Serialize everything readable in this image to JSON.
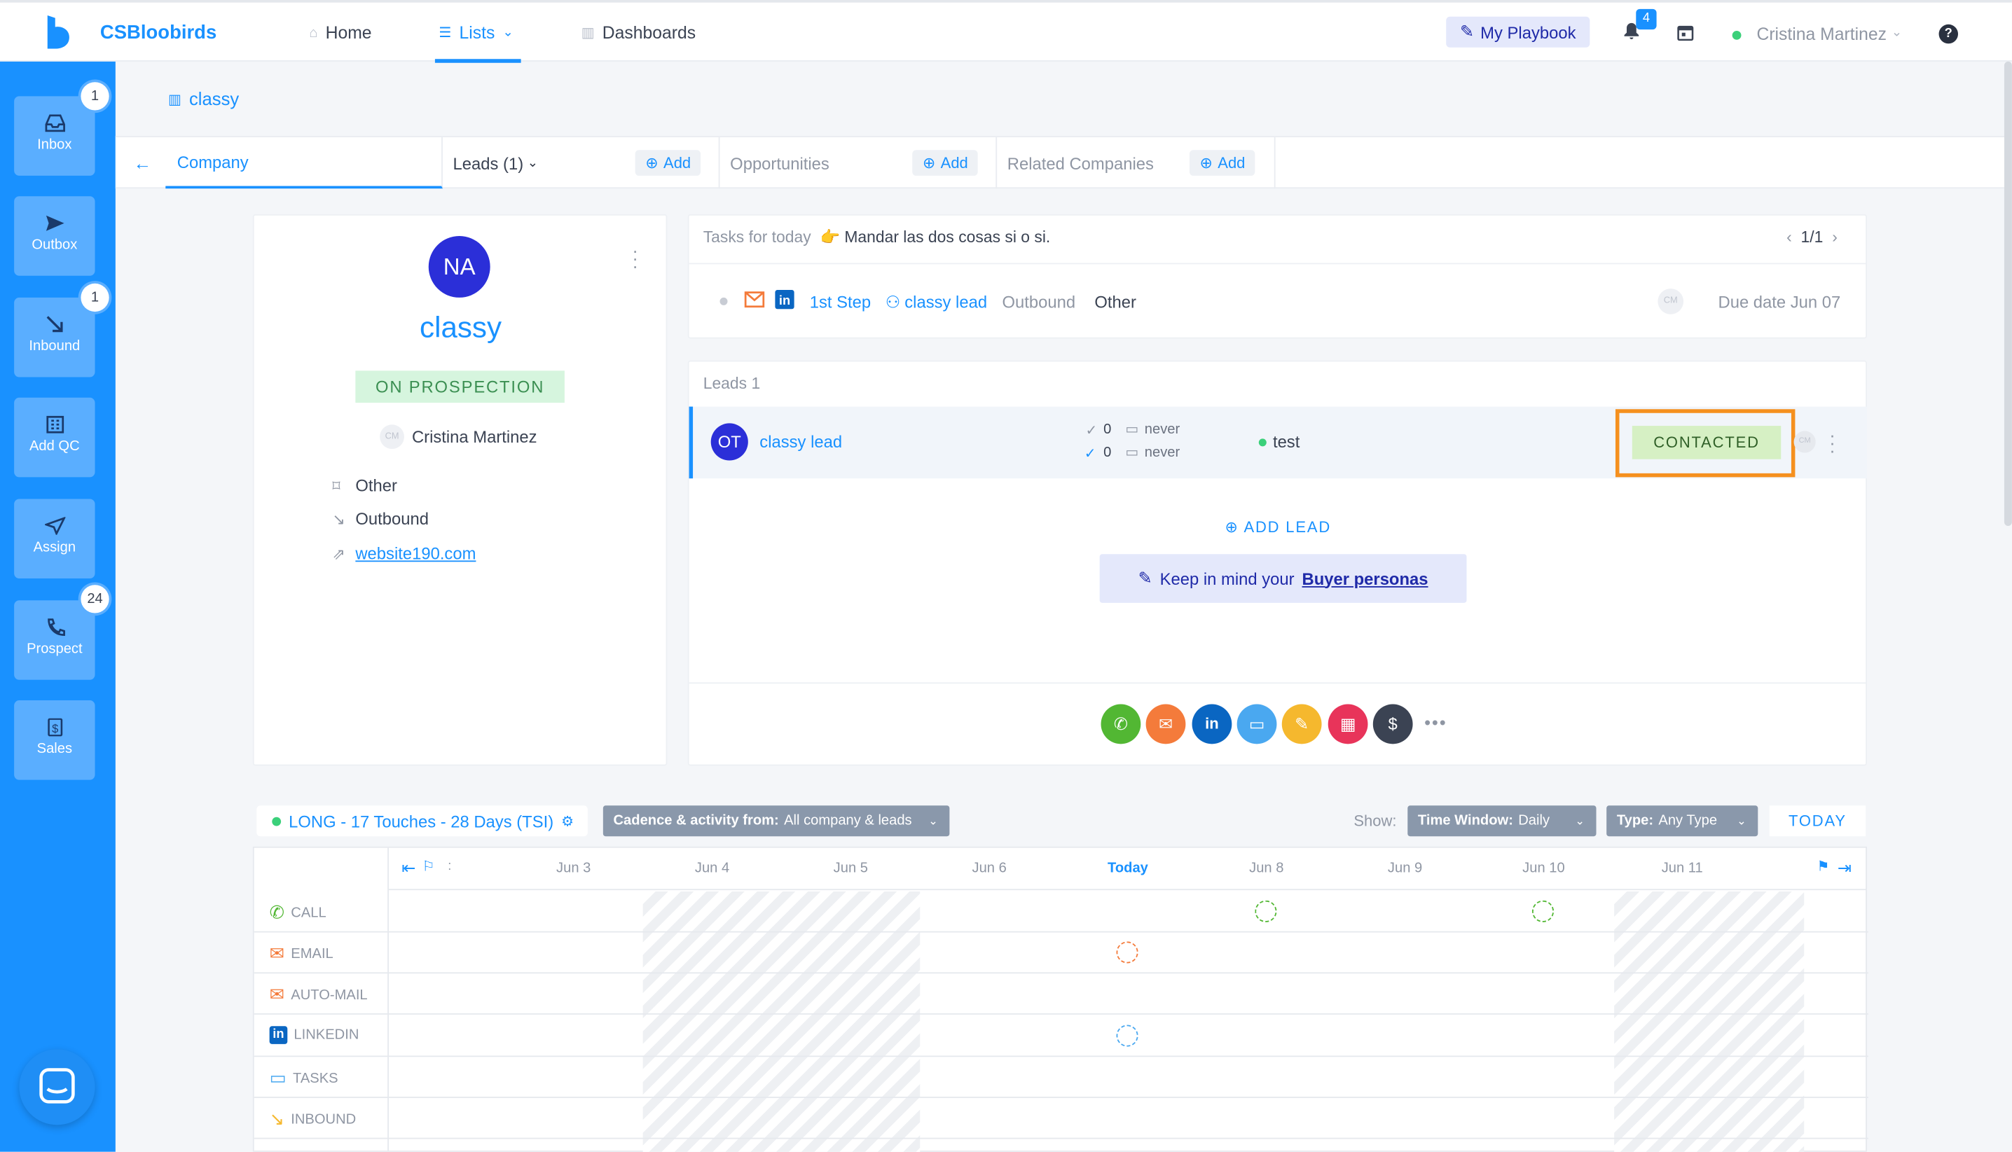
{
  "app": {
    "name": "CSBloobirds"
  },
  "topnav": {
    "home": "Home",
    "lists": "Lists",
    "dashboards": "Dashboards",
    "playbook": "My Playbook",
    "notifications": "4",
    "user": "Cristina Martinez",
    "help": "?"
  },
  "sidebar": {
    "items": [
      {
        "label": "Inbox",
        "badge": "1",
        "icon": "inbox-icon"
      },
      {
        "label": "Outbox",
        "badge": "",
        "icon": "send-icon"
      },
      {
        "label": "Inbound",
        "badge": "1",
        "icon": "arrow-down-right-icon"
      },
      {
        "label": "Add QC",
        "badge": "",
        "icon": "building-icon"
      },
      {
        "label": "Assign",
        "badge": "",
        "icon": "navigation-icon"
      },
      {
        "label": "Prospect",
        "badge": "24",
        "icon": "phone-icon"
      },
      {
        "label": "Sales",
        "badge": "",
        "icon": "dollar-icon"
      }
    ]
  },
  "breadcrumb": "classy",
  "tabs": {
    "company": "Company",
    "leads": "Leads (1)",
    "opportunities": "Opportunities",
    "related": "Related Companies",
    "add": "Add"
  },
  "company": {
    "initials": "NA",
    "name": "classy",
    "status": "ON PROSPECTION",
    "owner_initials": "CM",
    "owner": "Cristina Martinez",
    "source": "Other",
    "direction": "Outbound",
    "website": "website190.com"
  },
  "tasks": {
    "heading": "Tasks for today",
    "note": "👉 Mandar las dos cosas si o si.",
    "pager": "1/1",
    "step": "1st Step",
    "lead": "classy lead",
    "type": "Outbound",
    "source": "Other",
    "assignee": "CM",
    "due": "Due date Jun 07"
  },
  "leads": {
    "title": "Leads 1",
    "row": {
      "initials": "OT",
      "name": "classy lead",
      "count1": "0",
      "count2": "0",
      "last1": "never",
      "last2": "never",
      "tag": "test",
      "status": "CONTACTED",
      "assignee": "CM"
    },
    "add_lead": "ADD LEAD",
    "buyer_prefix": "Keep in mind your",
    "buyer_link": "Buyer personas"
  },
  "cadence": {
    "name": "LONG - 17 Touches - 28 Days (TSI)",
    "filter_label": "Cadence & activity from:",
    "filter_value": "All company & leads",
    "show": "Show:",
    "window_label": "Time Window:",
    "window_value": "Daily",
    "type_label": "Type:",
    "type_value": "Any Type",
    "today": "TODAY"
  },
  "timeline": {
    "days": [
      "Jun 3",
      "Jun 4",
      "Jun 5",
      "Jun 6",
      "Today",
      "Jun 8",
      "Jun 9",
      "Jun 10",
      "Jun 11"
    ],
    "rows": [
      "CALL",
      "EMAIL",
      "AUTO-MAIL",
      "LINKEDIN",
      "TASKS",
      "INBOUND"
    ]
  },
  "colors": {
    "brand": "#1991ff",
    "call": "#52b733",
    "email": "#f47b3b",
    "linkedin": "#0a66c2",
    "tasks": "#4aa8f0",
    "note": "#f5b82e",
    "meeting": "#e8345a",
    "deal": "#3b4353",
    "highlight": "#f5901e"
  }
}
